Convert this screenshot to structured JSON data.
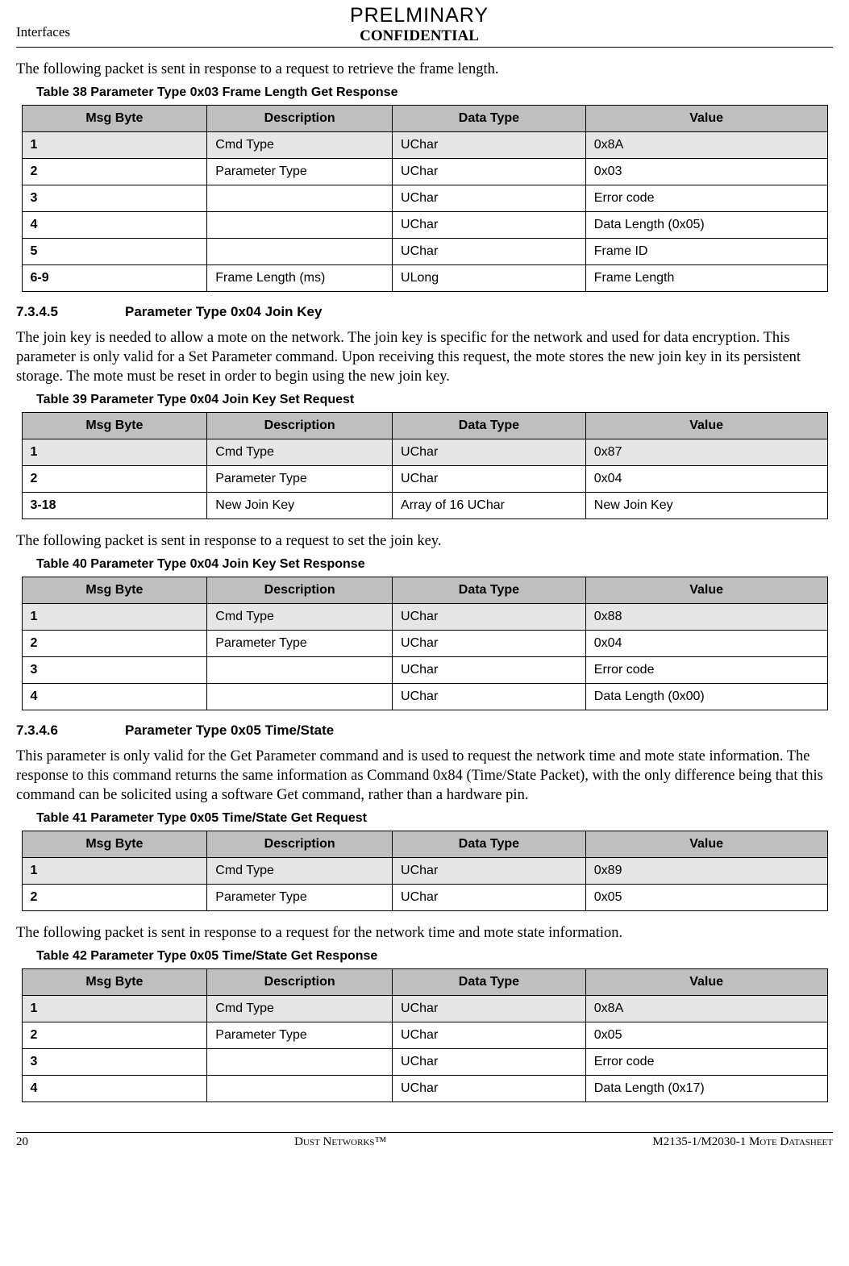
{
  "header": {
    "left": "Interfaces",
    "preliminary": "PRELMINARY",
    "confidential": "CONFIDENTIAL"
  },
  "intro38": "The following packet is sent in response to a request to retrieve the frame length.",
  "cap38": "Table 38   Parameter Type 0x03 Frame Length Get Response",
  "th": {
    "c1": "Msg Byte",
    "c2": "Description",
    "c3": "Data Type",
    "c4": "Value"
  },
  "t38": [
    {
      "b": "1",
      "d": "Cmd Type",
      "t": "UChar",
      "v": "0x8A"
    },
    {
      "b": "2",
      "d": "Parameter Type",
      "t": "UChar",
      "v": "0x03"
    },
    {
      "b": "3",
      "d": "",
      "t": "UChar",
      "v": "Error code"
    },
    {
      "b": "4",
      "d": "",
      "t": "UChar",
      "v": "Data Length (0x05)"
    },
    {
      "b": "5",
      "d": "",
      "t": "UChar",
      "v": "Frame ID"
    },
    {
      "b": "6-9",
      "d": "Frame Length (ms)",
      "t": "ULong",
      "v": "Frame Length"
    }
  ],
  "sec45": {
    "num": "7.3.4.5",
    "title": "Parameter Type 0x04 Join Key"
  },
  "para45": "The join key is needed to allow a mote on the network. The join key is specific for the network and used for data encryption. This parameter is only valid for a Set Parameter command. Upon receiving this request, the mote stores the new join key in its persistent storage. The mote must be reset in order to begin using the new join key.",
  "cap39": "Table 39   Parameter Type 0x04 Join Key Set Request",
  "t39": [
    {
      "b": "1",
      "d": "Cmd Type",
      "t": "UChar",
      "v": "0x87"
    },
    {
      "b": "2",
      "d": "Parameter Type",
      "t": "UChar",
      "v": "0x04"
    },
    {
      "b": "3-18",
      "d": "New Join Key",
      "t": "Array of 16 UChar",
      "v": "New Join Key"
    }
  ],
  "intro40": "The following packet is sent in response to a request to set the join key.",
  "cap40": "Table 40   Parameter Type 0x04 Join Key Set Response",
  "t40": [
    {
      "b": "1",
      "d": "Cmd Type",
      "t": "UChar",
      "v": "0x88"
    },
    {
      "b": "2",
      "d": "Parameter Type",
      "t": "UChar",
      "v": "0x04"
    },
    {
      "b": "3",
      "d": "",
      "t": "UChar",
      "v": "Error code"
    },
    {
      "b": "4",
      "d": "",
      "t": "UChar",
      "v": "Data Length (0x00)"
    }
  ],
  "sec46": {
    "num": "7.3.4.6",
    "title": "Parameter Type 0x05 Time/State"
  },
  "para46": "This parameter is only valid for the Get Parameter command and is used to request the network time and mote state information. The response to this command returns the same information as Command 0x84 (Time/State Packet), with the only difference being that this command can be solicited using a software Get command, rather than a hardware pin.",
  "cap41": "Table 41   Parameter Type 0x05 Time/State Get Request",
  "t41": [
    {
      "b": "1",
      "d": "Cmd Type",
      "t": "UChar",
      "v": "0x89"
    },
    {
      "b": "2",
      "d": "Parameter Type",
      "t": "UChar",
      "v": "0x05"
    }
  ],
  "intro42": "The following packet is sent in response to a request for the network time and mote state information.",
  "cap42": "Table 42   Parameter Type 0x05 Time/State Get Response",
  "t42": [
    {
      "b": "1",
      "d": "Cmd Type",
      "t": "UChar",
      "v": "0x8A"
    },
    {
      "b": "2",
      "d": "Parameter Type",
      "t": "UChar",
      "v": "0x05"
    },
    {
      "b": "3",
      "d": "",
      "t": "UChar",
      "v": "Error code"
    },
    {
      "b": "4",
      "d": "",
      "t": "UChar",
      "v": "Data Length (0x17)"
    }
  ],
  "footer": {
    "left": "20",
    "center": "Dust Networks™",
    "right": "M2135-1/M2030-1 Mote Datasheet"
  }
}
